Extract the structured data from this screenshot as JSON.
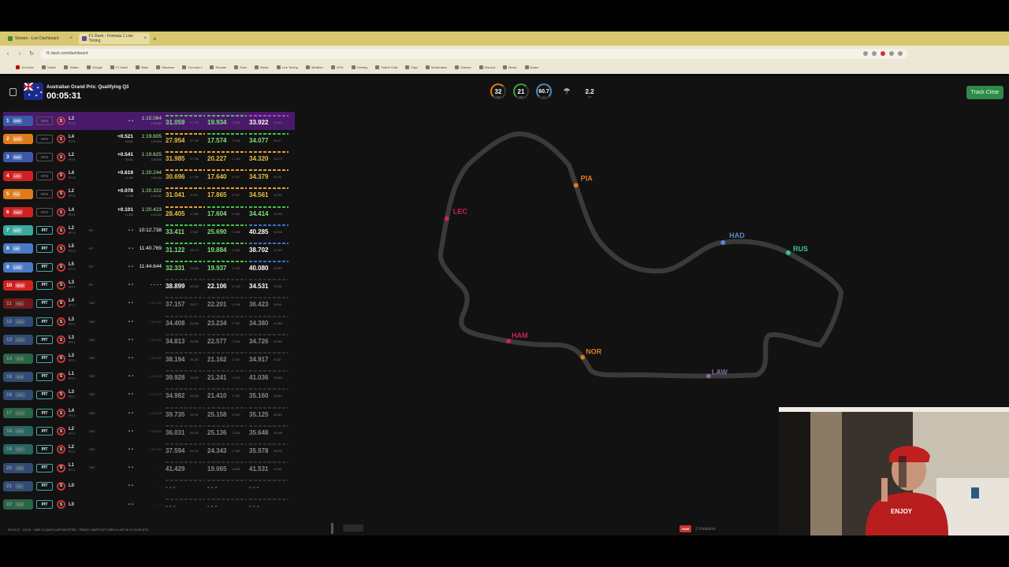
{
  "browser": {
    "tabs": [
      {
        "label": "Stream - Live Dashboard",
        "active": false
      },
      {
        "label": "F1 Dash - Formula 1 Live Timing",
        "active": true
      }
    ],
    "url": "f1-dash.com/dashboard",
    "bookmarks": [
      "YouTube",
      "Twitch",
      "Twitter",
      "Google",
      "F1 Dash",
      "Stats",
      "Streamer",
      "Formula 1",
      "Results",
      "Tools",
      "Radio",
      "Live Timing",
      "Weather",
      "GPU",
      "Overlay",
      "Twitch Chat",
      "Clips",
      "Moderation",
      "Scenes",
      "Discord",
      "Music",
      "Notes"
    ]
  },
  "header": {
    "session": "Australian Grand Prix: Qualifying Q3",
    "timer": "00:05:31",
    "weather": [
      {
        "value": "32",
        "unit": "TRC",
        "color": "#e07a1a"
      },
      {
        "value": "21",
        "unit": "AIR",
        "color": "#44a03a"
      },
      {
        "value": "60.7",
        "unit": "%",
        "color": "#4a8ac4"
      },
      {
        "value": "",
        "unit": "",
        "icon": "rain-icon"
      },
      {
        "value": "2.2",
        "unit": "m/s",
        "color": ""
      }
    ],
    "track_status": "Track Clear"
  },
  "drivers": [
    {
      "pos": "1",
      "code": "VER",
      "color": "#3a5aa8",
      "status": "DRS",
      "lap": "L3",
      "stint": "PIT 6",
      "gap": "- -",
      "interval": "- -",
      "interval_sub": "",
      "best": "1:15.084",
      "best_sub": "1:15.084",
      "s1": "31.059",
      "s1b": "27.792",
      "s2": "19.934",
      "s2b": "17.430",
      "s3": "33.922",
      "s3b": "33.801",
      "mini": [
        "g",
        "g",
        "p"
      ],
      "highlight": true
    },
    {
      "pos": "2",
      "code": "NOR",
      "color": "#e07a1a",
      "status": "DRS",
      "lap": "L4",
      "stint": "PIT 5",
      "gap": "",
      "interval": "+0.521",
      "interval_sub": "+0.521",
      "best": "1:19.605",
      "best_sub": "1:19.605",
      "s1": "27.954",
      "s1b": "27.798",
      "s2": "17.574",
      "s2b": "17.538",
      "s3": "34.077",
      "s3b": "34.077",
      "mini": [
        "y",
        "g",
        "g"
      ]
    },
    {
      "pos": "3",
      "code": "HAD",
      "color": "#3a5aa8",
      "status": "DRS",
      "lap": "L2",
      "stint": "PIT 5",
      "gap": "",
      "interval": "+0.541",
      "interval_sub": "+0.541",
      "best": "1:19.625",
      "best_sub": "1:19.625",
      "s1": "31.985",
      "s1b": "27.798",
      "s2": "20.227",
      "s2b": "17.453",
      "s3": "34.320",
      "s3b": "34.173",
      "mini": [
        "y",
        "y",
        "y"
      ]
    },
    {
      "pos": "4",
      "code": "LEC",
      "color": "#d02020",
      "status": "DRS",
      "lap": "L4",
      "stint": "PIT 5",
      "gap": "",
      "interval": "+0.619",
      "interval_sub": "+1.160",
      "best": "1:20.244",
      "best_sub": "1:20.244",
      "s1": "30.696",
      "s1b": "27.798",
      "s2": "17.640",
      "s2b": "17.527",
      "s3": "34.379",
      "s3b": "34.151",
      "mini": [
        "y",
        "y",
        "y"
      ]
    },
    {
      "pos": "5",
      "code": "PIA",
      "color": "#e07a1a",
      "status": "DRS",
      "lap": "L2",
      "stint": "PIT 5",
      "gap": "",
      "interval": "+0.078",
      "interval_sub": "+1.238",
      "best": "1:20.322",
      "best_sub": "1:20.322",
      "s1": "31.041",
      "s1b": "27.611",
      "s2": "17.865",
      "s2b": "17.527",
      "s3": "34.561",
      "s3b": "34.003",
      "mini": [
        "y",
        "y",
        "y"
      ]
    },
    {
      "pos": "6",
      "code": "HAM",
      "color": "#d02020",
      "status": "DRS",
      "lap": "L4",
      "stint": "PIT 5",
      "gap": "",
      "interval": "+0.101",
      "interval_sub": "+1.339",
      "best": "1:20.423",
      "best_sub": "1:20.423",
      "s1": "28.405",
      "s1b": "27.696",
      "s2": "17.604",
      "s2b": "17.604",
      "s3": "34.414",
      "s3b": "34.256",
      "mini": [
        "y",
        "g",
        "g"
      ]
    },
    {
      "pos": "7",
      "code": "ANT",
      "color": "#3aa8a0",
      "status": "PIT",
      "lap": "L2",
      "stint": "PIT 4",
      "gap": "PIT",
      "interval": "- -",
      "interval_sub": "",
      "best": "10:12.738",
      "best_sub": "",
      "s1": "33.411",
      "s1b": "27.837",
      "s2": "25.690",
      "s2b": "17.495",
      "s3": "40.285",
      "s3b": "33.936",
      "mini": [
        "g",
        "g",
        "b"
      ]
    },
    {
      "pos": "8",
      "code": "LIN",
      "color": "#4a7ac4",
      "status": "PIT",
      "lap": "L5",
      "stint": "PIT 4",
      "gap": "PIT",
      "interval": "- -",
      "interval_sub": "",
      "best": "11:40.769",
      "best_sub": "",
      "s1": "31.122",
      "s1b": "28.173",
      "s2": "19.884",
      "s2b": "17.532",
      "s3": "38.702",
      "s3b": "34.418",
      "mini": [
        "g",
        "g",
        "b"
      ]
    },
    {
      "pos": "9",
      "code": "LAW",
      "color": "#4a7ac4",
      "status": "PIT",
      "lap": "L5",
      "stint": "PIT 4",
      "gap": "PIT",
      "interval": "- -",
      "interval_sub": "",
      "best": "11:44.644",
      "best_sub": "",
      "s1": "32.331",
      "s1b": "28.168",
      "s2": "19.937",
      "s2b": "17.490",
      "s3": "40.080",
      "s3b": "34.352",
      "mini": [
        "g",
        "g",
        "b"
      ]
    },
    {
      "pos": "10",
      "code": "BOR",
      "color": "#d02020",
      "status": "PIT",
      "lap": "L3",
      "stint": "PIT 2",
      "gap": "PIT",
      "interval": "- -",
      "interval_sub": "",
      "best": "- - - -",
      "best_sub": "",
      "s1": "38.899",
      "s1b": "28.263",
      "s2": "22.106",
      "s2b": "17.418",
      "s3": "34.531",
      "s3b": "34.531",
      "mini": [
        "n",
        "n",
        "n"
      ]
    },
    {
      "pos": "11",
      "code": "HUL",
      "color": "#c02020",
      "status": "PIT",
      "lap": "L4",
      "stint": "PIT 2",
      "gap": "OUT",
      "interval": "- -",
      "interval_sub": "",
      "best": "1:20.302",
      "best_sub": "",
      "s1": "37.157",
      "s1b": "28.377",
      "s2": "22.201",
      "s2b": "17.446",
      "s3": "36.423",
      "s3b": "34.541",
      "mini": [
        "n",
        "n",
        "n"
      ],
      "out": true
    },
    {
      "pos": "12",
      "code": "GAS",
      "color": "#4a7ac4",
      "status": "PIT",
      "lap": "L3",
      "stint": "PIT 2",
      "gap": "OUT",
      "interval": "- -",
      "interval_sub": "",
      "best": "1:20.531",
      "best_sub": "",
      "s1": "34.408",
      "s1b": "28.482",
      "s2": "23.234",
      "s2b": "17.547",
      "s3": "34.380",
      "s3b": "34.380",
      "mini": [
        "n",
        "n",
        "n"
      ],
      "out": true
    },
    {
      "pos": "13",
      "code": "OCO",
      "color": "#4a7ac4",
      "status": "PIT",
      "lap": "L3",
      "stint": "PIT 2",
      "gap": "OUT",
      "interval": "- -",
      "interval_sub": "",
      "best": "1:20.491",
      "best_sub": "",
      "s1": "34.813",
      "s1b": "28.409",
      "s2": "22.577",
      "s2b": "17.506",
      "s3": "34.726",
      "s3b": "34.466",
      "mini": [
        "n",
        "n",
        "n"
      ],
      "out": true
    },
    {
      "pos": "14",
      "code": "STR",
      "color": "#3aa870",
      "status": "PIT",
      "lap": "L3",
      "stint": "PIT 2",
      "gap": "OUT",
      "interval": "- -",
      "interval_sub": "",
      "best": "1:20.531",
      "best_sub": "",
      "s1": "38.194",
      "s1b": "28.263",
      "s2": "21.162",
      "s2b": "17.487",
      "s3": "34.917",
      "s3b": "34.517",
      "mini": [
        "n",
        "n",
        "n"
      ],
      "out": true
    },
    {
      "pos": "15",
      "code": "ALB",
      "color": "#4a7ac4",
      "status": "PIT",
      "lap": "L1",
      "stint": "PIT 2",
      "gap": "OUT",
      "interval": "- -",
      "interval_sub": "",
      "best": "1:20.948",
      "best_sub": "",
      "s1": "39.928",
      "s1b": "28.252",
      "s2": "21.241",
      "s2b": "17.679",
      "s3": "41.036",
      "s3b": "34.809",
      "mini": [
        "n",
        "n",
        "n"
      ],
      "out": true
    },
    {
      "pos": "16",
      "code": "COL",
      "color": "#4a7ac4",
      "status": "PIT",
      "lap": "L3",
      "stint": "PIT 2",
      "gap": "OUT",
      "interval": "- -",
      "interval_sub": "",
      "best": "1:21.270",
      "best_sub": "",
      "s1": "34.982",
      "s1b": "28.185",
      "s2": "21.410",
      "s2b": "17.567",
      "s3": "35.160",
      "s3b": "34.874",
      "mini": [
        "n",
        "n",
        "n"
      ],
      "out": true
    },
    {
      "pos": "17",
      "code": "ALO",
      "color": "#3aa870",
      "status": "PIT",
      "lap": "L4",
      "stint": "PIT 2",
      "gap": "OUT",
      "interval": "- -",
      "interval_sub": "",
      "best": "1:21.009",
      "best_sub": "",
      "s1": "39.735",
      "s1b": "28.701",
      "s2": "25.158",
      "s2b": "17.657",
      "s3": "35.125",
      "s3b": "35.053",
      "mini": [
        "n",
        "n",
        "n"
      ],
      "out": true
    },
    {
      "pos": "18",
      "code": "PER",
      "color": "#3aa8a0",
      "status": "PIT",
      "lap": "L2",
      "stint": "PIT 2",
      "gap": "OUT",
      "interval": "- -",
      "interval_sub": "",
      "best": "1:22.858",
      "best_sub": "",
      "s1": "36.031",
      "s1b": "29.132",
      "s2": "25.136",
      "s2b": "17.618",
      "s3": "35.648",
      "s3b": "35.648",
      "mini": [
        "n",
        "n",
        "n"
      ],
      "out": true
    },
    {
      "pos": "19",
      "code": "BOT",
      "color": "#3aa8a0",
      "status": "PIT",
      "lap": "L2",
      "stint": "PIT 2",
      "gap": "OUT",
      "interval": "- -",
      "interval_sub": "",
      "best": "1:23.350",
      "best_sub": "",
      "s1": "37.594",
      "s1b": "29.133",
      "s2": "24.343",
      "s2b": "17.653",
      "s3": "35.978",
      "s3b": "35.978",
      "mini": [
        "n",
        "n",
        "n"
      ],
      "out": true
    },
    {
      "pos": "20",
      "code": "VER",
      "color": "#4a7ac4",
      "status": "PIT",
      "lap": "L1",
      "stint": "PIT 2",
      "gap": "OUT",
      "interval": "- -",
      "interval_sub": "",
      "best": "- - - -",
      "best_sub": "",
      "s1": "41.429",
      "s1b": "",
      "s2": "19.065",
      "s2b": "18.065",
      "s3": "41.531",
      "s3b": "41.531",
      "mini": [
        "n",
        "n",
        "n"
      ],
      "out": true
    },
    {
      "pos": "21",
      "code": "SAI",
      "color": "#4a7ac4",
      "status": "PIT",
      "lap": "L0",
      "stint": "",
      "gap": "",
      "interval": "- -",
      "interval_sub": "",
      "best": "- - - -",
      "best_sub": "",
      "s1": "- - -",
      "s1b": "",
      "s2": "- - -",
      "s2b": "",
      "s3": "- - -",
      "s3b": "",
      "mini": [
        "n",
        "n",
        "n"
      ],
      "out": true
    },
    {
      "pos": "22",
      "code": "STR",
      "color": "#3aa870",
      "status": "PIT",
      "lap": "L0",
      "stint": "",
      "gap": "",
      "interval": "- -",
      "interval_sub": "",
      "best": "- - - -",
      "best_sub": "",
      "s1": "- - -",
      "s1b": "",
      "s2": "- - -",
      "s2b": "",
      "s3": "- - -",
      "s3b": "",
      "mini": [
        "n",
        "n",
        "n"
      ],
      "out": true
    }
  ],
  "track_labels": [
    {
      "code": "LEC",
      "color": "#d02050"
    },
    {
      "code": "PIA",
      "color": "#e07a1a"
    },
    {
      "code": "HAD",
      "color": "#5a8ad0"
    },
    {
      "code": "RUS",
      "color": "#3ac0a0"
    },
    {
      "code": "HAM",
      "color": "#d02050"
    },
    {
      "code": "NOR",
      "color": "#e07a1a"
    },
    {
      "code": "LAW",
      "color": "#8a6a9a"
    }
  ],
  "footer": {
    "ticker": "03:13:37 · 03:13 · CAR 12 (ANT) LAP DELETED - TRACK LIMITS AT TURN 3 LAP 18 17:41:59 (P7)",
    "violation_driver": "HAM",
    "violation_text": "3 Violations"
  }
}
